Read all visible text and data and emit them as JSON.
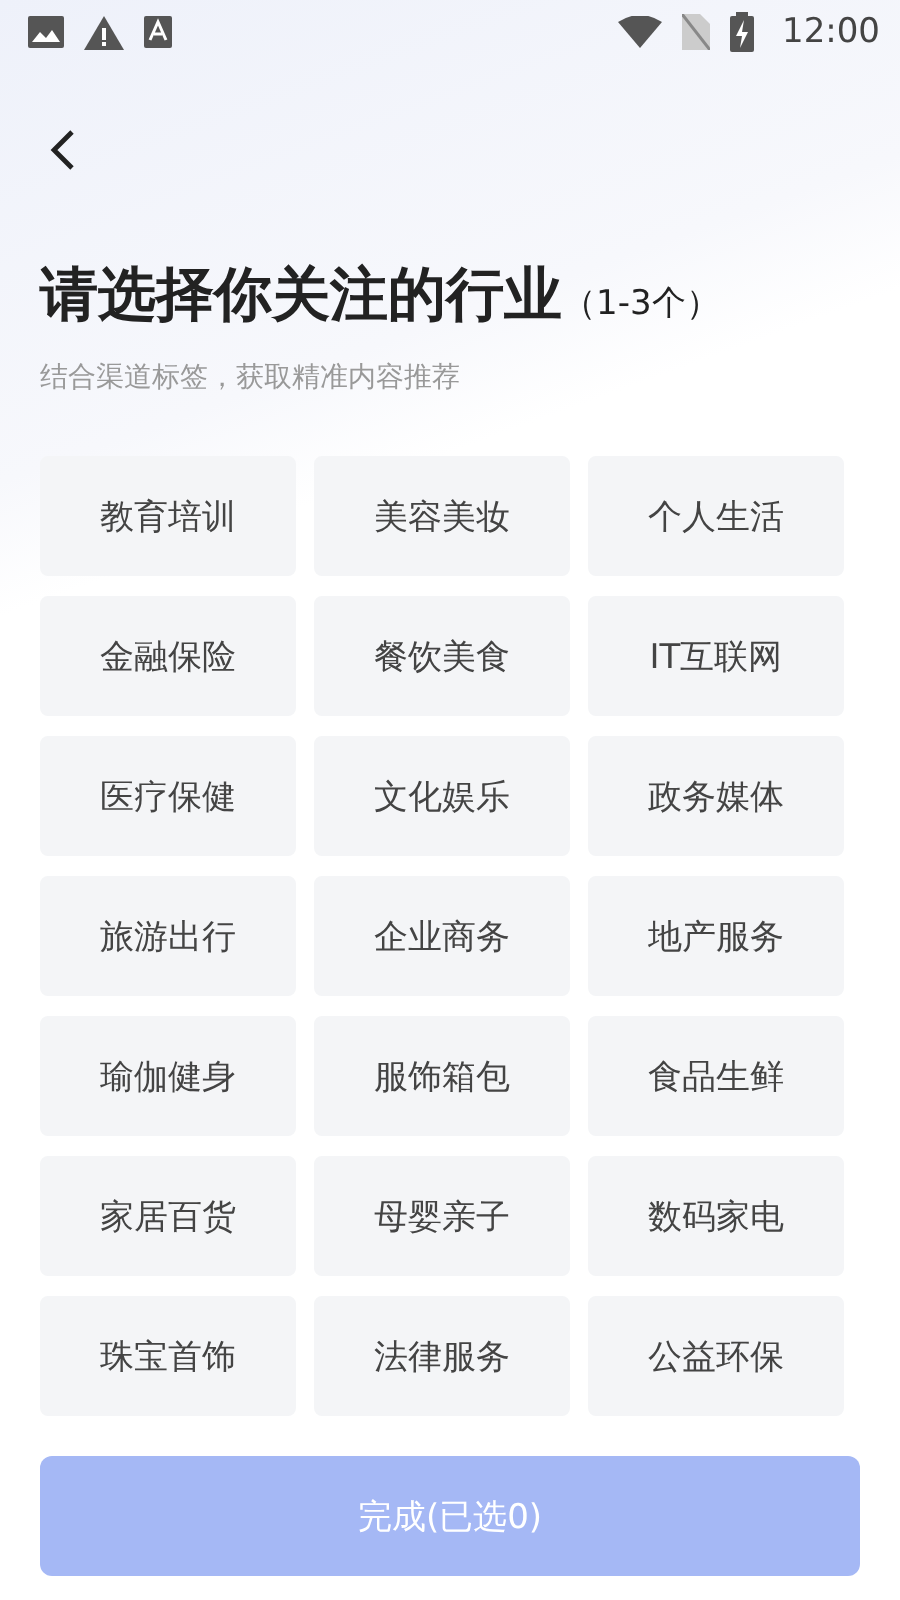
{
  "status_bar": {
    "time": "12:00"
  },
  "header": {
    "title": "请选择你关注的行业",
    "title_hint": "（1-3个）",
    "subtitle": "结合渠道标签，获取精准内容推荐"
  },
  "industries": [
    {
      "label": "教育培训",
      "selected": false
    },
    {
      "label": "美容美妆",
      "selected": false
    },
    {
      "label": "个人生活",
      "selected": false
    },
    {
      "label": "金融保险",
      "selected": false
    },
    {
      "label": "餐饮美食",
      "selected": false
    },
    {
      "label": "IT互联网",
      "selected": false
    },
    {
      "label": "医疗保健",
      "selected": false
    },
    {
      "label": "文化娱乐",
      "selected": false
    },
    {
      "label": "政务媒体",
      "selected": false
    },
    {
      "label": "旅游出行",
      "selected": false
    },
    {
      "label": "企业商务",
      "selected": false
    },
    {
      "label": "地产服务",
      "selected": false
    },
    {
      "label": "瑜伽健身",
      "selected": false
    },
    {
      "label": "服饰箱包",
      "selected": false
    },
    {
      "label": "食品生鲜",
      "selected": false
    },
    {
      "label": "家居百货",
      "selected": false
    },
    {
      "label": "母婴亲子",
      "selected": false
    },
    {
      "label": "数码家电",
      "selected": false
    },
    {
      "label": "珠宝首饰",
      "selected": false
    },
    {
      "label": "法律服务",
      "selected": false
    },
    {
      "label": "公益环保",
      "selected": false
    }
  ],
  "done_button": {
    "label": "完成(已选0)",
    "disabled": true
  }
}
